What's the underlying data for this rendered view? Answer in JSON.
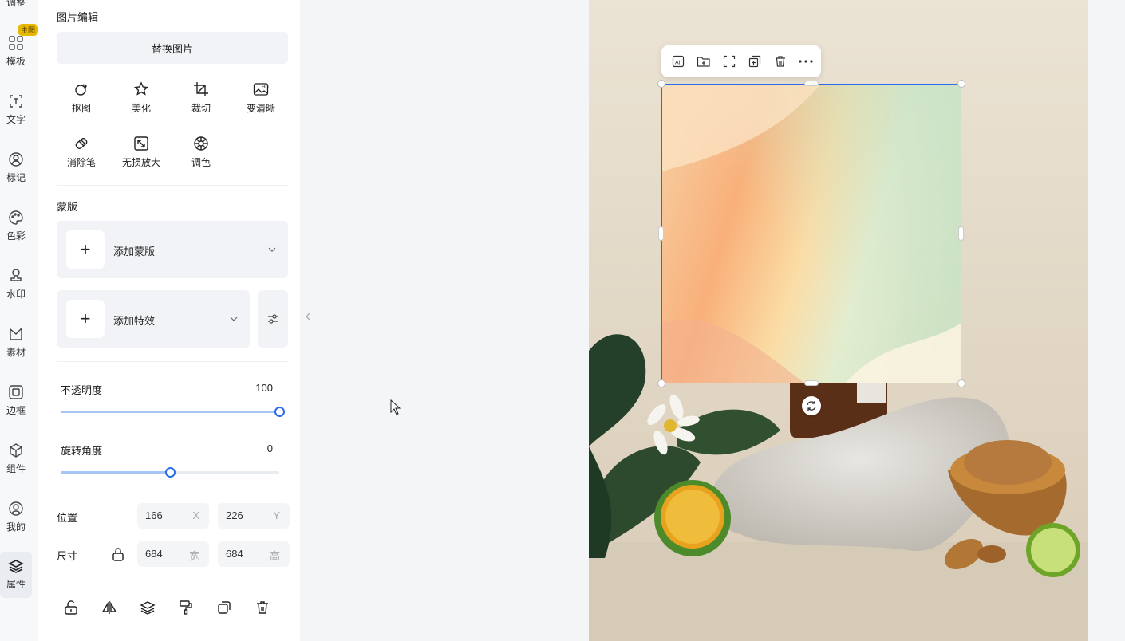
{
  "rail": {
    "items": [
      {
        "label": "调整"
      },
      {
        "label": "模板",
        "badge": "主图"
      },
      {
        "label": "文字"
      },
      {
        "label": "标记"
      },
      {
        "label": "色彩"
      },
      {
        "label": "水印"
      },
      {
        "label": "素材"
      },
      {
        "label": "边框"
      },
      {
        "label": "组件"
      },
      {
        "label": "我的"
      },
      {
        "label": "属性"
      }
    ]
  },
  "panel": {
    "image_edit_title": "图片编辑",
    "replace_label": "替换图片",
    "tools": [
      {
        "label": "抠图",
        "icon": "cutout-icon"
      },
      {
        "label": "美化",
        "icon": "beautify-icon"
      },
      {
        "label": "裁切",
        "icon": "crop-icon"
      },
      {
        "label": "变清晰",
        "icon": "hd-icon"
      },
      {
        "label": "消除笔",
        "icon": "eraser-icon"
      },
      {
        "label": "无损放大",
        "icon": "upscale-icon"
      },
      {
        "label": "调色",
        "icon": "color-adjust-icon"
      }
    ],
    "mask_title": "蒙版",
    "add_mask_label": "添加蒙版",
    "add_effect_label": "添加特效",
    "opacity": {
      "label": "不透明度",
      "value": "100",
      "fraction": 1.0
    },
    "rotation": {
      "label": "旋转角度",
      "value": "0",
      "fraction": 0.5
    },
    "position": {
      "label": "位置",
      "x": "166",
      "x_unit": "X",
      "y": "226",
      "y_unit": "Y"
    },
    "size": {
      "label": "尺寸",
      "w": "684",
      "w_unit": "宽",
      "h": "684",
      "h_unit": "高"
    }
  },
  "colors": {
    "accent": "#2a6cf0",
    "badge": "#e6b800"
  }
}
